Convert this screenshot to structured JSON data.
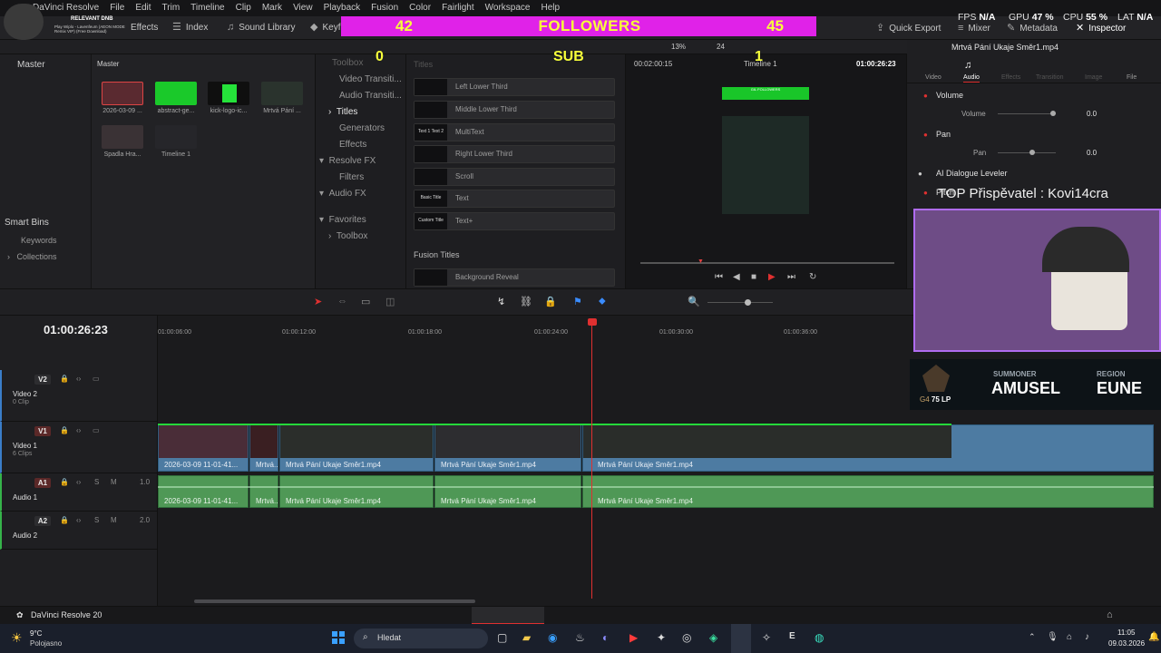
{
  "overlay": {
    "followers_label": "FOLLOWERS",
    "followers_left": "42",
    "followers_right": "45",
    "sub_label": "SUB",
    "sub_left": "0",
    "sub_right": "1",
    "top_supporter": "TOP Přispěvatel : Kovi14cra",
    "summoner_label": "SUMMONER",
    "summoner_name": "AMUSEL",
    "region_label": "REGION",
    "region_value": "EUNE",
    "rank_text": "G4",
    "lp_text": "75 LP",
    "relevant_dnb": "RELEVANT DNB",
    "now_playing": "Play Wiplo - Lavenfeum (AEON MODE Remix VIP) (Free Download)"
  },
  "menu": [
    "DaVinci Resolve",
    "File",
    "Edit",
    "Trim",
    "Timeline",
    "Clip",
    "Mark",
    "View",
    "Playback",
    "Fusion",
    "Color",
    "Fairlight",
    "Workspace",
    "Help"
  ],
  "toolbar": {
    "effects_label": "Effects",
    "index_label": "Index",
    "sound_library_label": "Sound Library",
    "keyframes_label": "Keyframes",
    "quick_export_label": "Quick Export",
    "mixer_label": "Mixer",
    "metadata_label": "Metadata",
    "inspector_label": "Inspector"
  },
  "stats": {
    "fps_label": "FPS",
    "fps_value": "N/A",
    "gpu_label": "GPU",
    "gpu_value": "47 %",
    "cpu_label": "CPU",
    "cpu_value": "55 %",
    "lat_label": "LAT",
    "lat_value": "N/A"
  },
  "media_pool": {
    "master_left": "Master",
    "master_right": "Master",
    "smart_bins": "Smart Bins",
    "keywords": "Keywords",
    "collections": "Collections",
    "clips": [
      {
        "name": "2026-03-09 ..."
      },
      {
        "name": "abstract-ge..."
      },
      {
        "name": "kick-logo-ic..."
      },
      {
        "name": "Mrtvá Pání ..."
      },
      {
        "name": "Spadla Hra..."
      },
      {
        "name": "Timeline 1"
      }
    ]
  },
  "effects_tree": {
    "toolbox": "Toolbox",
    "video_transitions": "Video Transiti...",
    "audio_transitions": "Audio Transiti...",
    "titles": "Titles",
    "generators": "Generators",
    "effects": "Effects",
    "resolve_fx": "Resolve FX",
    "filters": "Filters",
    "audio_fx": "Audio FX",
    "favorites": "Favorites",
    "toolbox2": "Toolbox"
  },
  "titles_panel": {
    "header": "Titles",
    "items": [
      {
        "thumb": "",
        "label": "Left Lower Third"
      },
      {
        "thumb": "",
        "label": "Middle Lower Third"
      },
      {
        "thumb": "Text 1 Text 2",
        "label": "MultiText"
      },
      {
        "thumb": "",
        "label": "Right Lower Third"
      },
      {
        "thumb": "",
        "label": "Scroll"
      },
      {
        "thumb": "Basic Title",
        "label": "Text"
      },
      {
        "thumb": "Custom Title",
        "label": "Text+"
      }
    ],
    "fusion_header": "Fusion Titles",
    "fusion_item": "Background Reveal"
  },
  "viewer": {
    "zoom": "13%",
    "fps": "24",
    "source_tc": "00:02:00:15",
    "timeline_name": "Timeline 1",
    "record_tc": "01:00:26:23",
    "clip_title": "Mrtvá Pání Ukaje Směr1.mp4",
    "overlay_text": "GIL FOLLOWERS"
  },
  "inspector": {
    "tabs": [
      "Video",
      "Audio",
      "Effects",
      "Transition",
      "Image",
      "File"
    ],
    "active_tab": "Audio",
    "volume_header": "Volume",
    "volume_label": "Volume",
    "volume_value": "0.0",
    "pan_header": "Pan",
    "pan_label": "Pan",
    "pan_value": "0.0",
    "dialogue_leveler": "AI Dialogue Leveler",
    "pitch": "Pitch"
  },
  "timeline": {
    "timecode": "01:00:26:23",
    "ruler": [
      "01:00:06:00",
      "01:00:12:00",
      "01:00:18:00",
      "01:00:24:00",
      "01:00:30:00",
      "01:00:36:00"
    ],
    "tracks": {
      "v2": {
        "tag": "V2",
        "name": "Video 2",
        "count": "0 Clip"
      },
      "v1": {
        "tag": "V1",
        "name": "Video 1",
        "count": "6 Clips"
      },
      "a1": {
        "tag": "A1",
        "name": "Audio 1",
        "level": "1.0"
      },
      "a2": {
        "tag": "A2",
        "name": "Audio 2",
        "level": "2.0"
      }
    },
    "clips": [
      {
        "video": "2026-03-09 11-01-41...",
        "audio": "2026-03-09 11-01-41..."
      },
      {
        "video": "Mrtvá...",
        "audio": "Mrtvá..."
      },
      {
        "video": "Mrtvá Pání Ukaje Směr1.mp4",
        "audio": "Mrtvá Pání Ukaje Směr1.mp4"
      },
      {
        "video": "Mrtvá Pání Ukaje Směr1.mp4",
        "audio": "Mrtvá Pání Ukaje Směr1.mp4"
      },
      {
        "video": "Mrtvá Pání Ukaje Směr1.mp4",
        "audio": "Mrtvá Pání Ukaje Směr1.mp4"
      }
    ]
  },
  "status": {
    "app": "DaVinci Resolve 20"
  },
  "taskbar": {
    "weather_temp": "9°C",
    "weather_desc": "Polojasno",
    "search_placeholder": "Hledat",
    "time": "11:05",
    "date": "09.03.2026"
  }
}
